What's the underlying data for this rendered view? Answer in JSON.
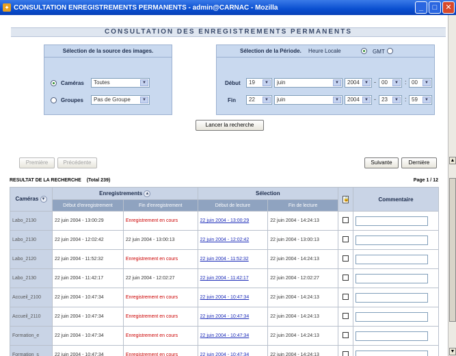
{
  "window": {
    "title": "CONSULTATION ENREGISTREMENTS PERMANENTS - admin@CARNAC - Mozilla",
    "minimize_icon": "minimize-icon",
    "maximize_icon": "maximize-icon",
    "close_icon": "close-icon"
  },
  "page": {
    "title": "CONSULTATION DES ENREGISTREMENTS PERMANENTS"
  },
  "source": {
    "heading": "Sélection de la source des images.",
    "cameras_label": "Caméras",
    "cameras_value": "Toutes",
    "groupes_label": "Groupes",
    "groupes_value": "Pas de Groupe"
  },
  "periode": {
    "heading": "Sélection de la Période.",
    "heure_locale": "Heure Locale",
    "gmt": "GMT",
    "debut_label": "Début",
    "fin_label": "Fin",
    "debut": {
      "day": "19",
      "month": "juin",
      "year": "2004",
      "hour": "00",
      "minute": "00"
    },
    "fin": {
      "day": "22",
      "month": "juin",
      "year": "2004",
      "hour": "23",
      "minute": "59"
    }
  },
  "search_button": "Lancer la recherche",
  "nav": {
    "premiere": "Première",
    "precedente": "Précédente",
    "suivante": "Suivante",
    "derniere": "Dernière"
  },
  "results": {
    "title": "RESULTAT DE LA RECHERCHE",
    "total": "(Total 239)",
    "page": "Page 1 / 12",
    "headers": {
      "cameras": "Caméras",
      "enregistrements": "Enregistrements",
      "selection": "Sélection",
      "commentaire": "Commentaire",
      "debut_enr": "Début d'enregistrement",
      "fin_enr": "Fin d'enregistrement",
      "debut_lect": "Début de lecture",
      "fin_lect": "Fin de lecture"
    },
    "rows": [
      {
        "camera": "Labo_2130",
        "debut": "22 juin 2004 - 13:00:29",
        "fin": "Enregistrement en cours",
        "debut_lect": "22 juin 2004 - 13:00:29",
        "fin_lect": "22 juin 2004 - 14:24:13"
      },
      {
        "camera": "Labo_2130",
        "debut": "22 juin 2004 - 12:02:42",
        "fin": "22 juin 2004 - 13:00:13",
        "debut_lect": "22 juin 2004 - 12:02:42",
        "fin_lect": "22 juin 2004 - 13:00:13"
      },
      {
        "camera": "Labo_2120",
        "debut": "22 juin 2004 - 11:52:32",
        "fin": "Enregistrement en cours",
        "debut_lect": "22 juin 2004 - 11:52:32",
        "fin_lect": "22 juin 2004 - 14:24:13"
      },
      {
        "camera": "Labo_2130",
        "debut": "22 juin 2004 - 11:42:17",
        "fin": "22 juin 2004 - 12:02:27",
        "debut_lect": "22 juin 2004 - 11:42:17",
        "fin_lect": "22 juin 2004 - 12:02:27"
      },
      {
        "camera": "Accueil_2100",
        "debut": "22 juin 2004 - 10:47:34",
        "fin": "Enregistrement en cours",
        "debut_lect": "22 juin 2004 - 10:47:34",
        "fin_lect": "22 juin 2004 - 14:24:13"
      },
      {
        "camera": "Accueil_2110",
        "debut": "22 juin 2004 - 10:47:34",
        "fin": "Enregistrement en cours",
        "debut_lect": "22 juin 2004 - 10:47:34",
        "fin_lect": "22 juin 2004 - 14:24:13"
      },
      {
        "camera": "Formation_e",
        "debut": "22 juin 2004 - 10:47:34",
        "fin": "Enregistrement en cours",
        "debut_lect": "22 juin 2004 - 10:47:34",
        "fin_lect": "22 juin 2004 - 14:24:13"
      },
      {
        "camera": "Formation_s",
        "debut": "22 juin 2004 - 10:47:34",
        "fin": "Enregistrement en cours",
        "debut_lect": "22 juin 2004 - 10:47:34",
        "fin_lect": "22 juin 2004 - 14:24:13"
      }
    ]
  }
}
